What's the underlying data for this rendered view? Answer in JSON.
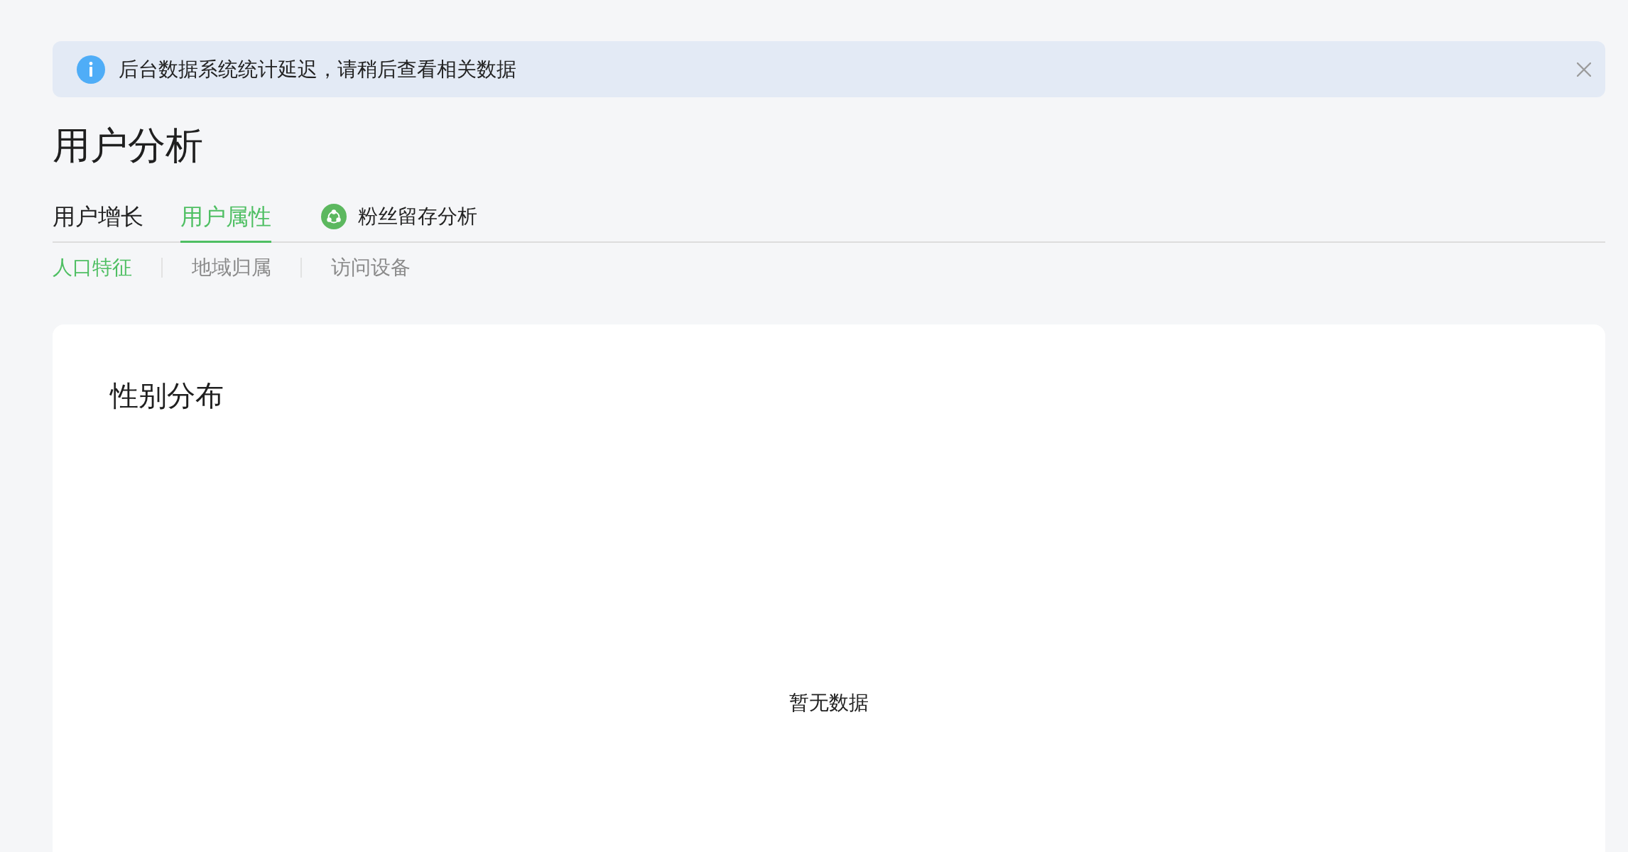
{
  "notice": {
    "text": "后台数据系统统计延迟，请稍后查看相关数据"
  },
  "page_title": "用户分析",
  "tabs": [
    {
      "label": "用户增长",
      "selected": false,
      "kind": "plain"
    },
    {
      "label": "用户属性",
      "selected": true,
      "kind": "plain"
    },
    {
      "label": "粉丝留存分析",
      "selected": false,
      "kind": "icon"
    }
  ],
  "subtabs": [
    {
      "label": "人口特征",
      "selected": true
    },
    {
      "label": "地域归属",
      "selected": false
    },
    {
      "label": "访问设备",
      "selected": false
    }
  ],
  "card": {
    "title": "性别分布",
    "empty_text": "暂无数据"
  }
}
